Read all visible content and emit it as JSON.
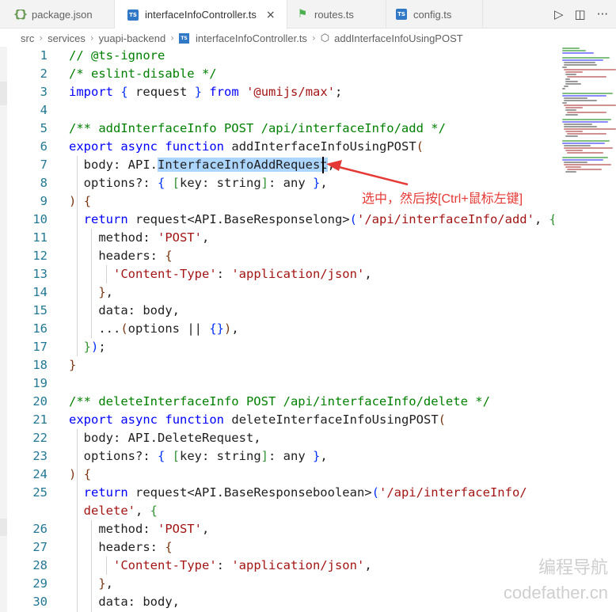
{
  "tabs": [
    {
      "label": "package.json",
      "icon": "json-icon"
    },
    {
      "label": "interfaceInfoController.ts",
      "icon": "typescript-icon",
      "close": "×"
    },
    {
      "label": "routes.ts",
      "icon": "route-icon"
    },
    {
      "label": "config.ts",
      "icon": "typescript-icon"
    }
  ],
  "actions": {
    "run": "▷",
    "split": "◫",
    "more": "···"
  },
  "breadcrumb": [
    "src",
    "services",
    "yuapi-backend",
    "interfaceInfoController.ts",
    "addInterfaceInfoUsingPOST"
  ],
  "code": {
    "l1": "// @ts-ignore",
    "l2": "/* eslint-disable */",
    "l3_import": "import",
    "l3_request": "request",
    "l3_from": "from",
    "l3_src": "'@umijs/max'",
    "l5": "/** addInterfaceInfo POST /api/interfaceInfo/add */",
    "l6_fn": "addInterfaceInfoUsingPOST",
    "l7_pre": "body: API.",
    "l7_sel": "InterfaceInfoAddRequest",
    "l10_req": "request<API.BaseResponselong>",
    "l10_url": "'/api/interfaceInfo/add'",
    "post": "'POST'",
    "content_type": "'Content-Type'",
    "app_json": "'application/json'",
    "l20": "/** deleteInterfaceInfo POST /api/interfaceInfo/delete */",
    "l21_fn": "deleteInterfaceInfoUsingPOST",
    "l22": "body: API.DeleteRequest,",
    "l25_req": "request<API.BaseResponseboolean>",
    "l25_url_a": "'/api/interfaceInfo/",
    "l25_url_b": "delete'"
  },
  "line_numbers": [
    "1",
    "2",
    "3",
    "4",
    "5",
    "6",
    "7",
    "8",
    "9",
    "10",
    "11",
    "12",
    "13",
    "14",
    "15",
    "16",
    "17",
    "18",
    "19",
    "20",
    "21",
    "22",
    "23",
    "24",
    "25",
    "26",
    "27",
    "28",
    "29",
    "30"
  ],
  "annotation": "选中，然后按[Ctrl+鼠标左键]",
  "watermark": [
    "编程导航",
    "codefather.cn"
  ],
  "colors": {
    "comment": "#008000",
    "keyword": "#0000ff",
    "string": "#a31515",
    "selection": "#add6ff",
    "annotation": "#e53935",
    "line_number": "#237893"
  }
}
